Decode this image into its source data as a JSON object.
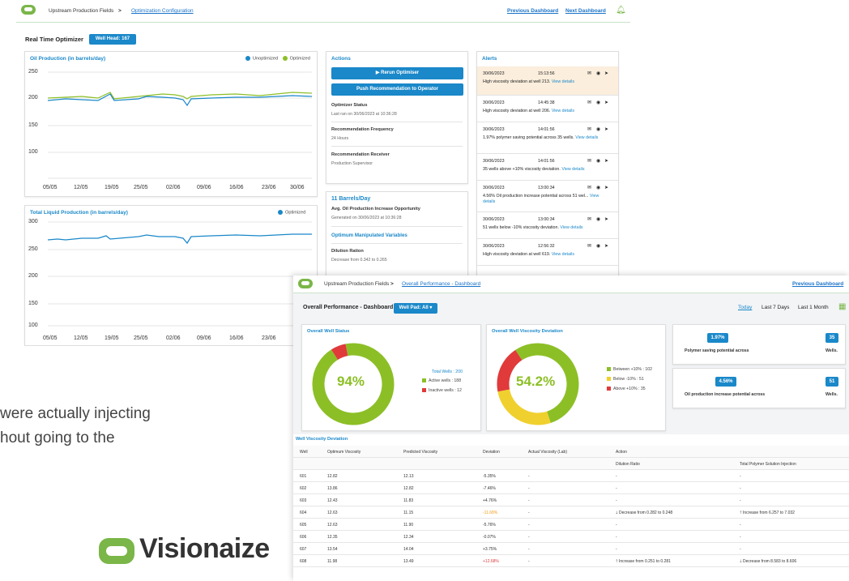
{
  "s1": {
    "breadcrumb": {
      "item1": "Upstream Production Fields",
      "sep": ">",
      "current": "Optimization Configuration"
    },
    "nav": {
      "prev": "Previous Dashboard",
      "next": "Next Dashboard"
    },
    "title": "Real Time Optimizer",
    "wellhead_badge": "Well Head: 167",
    "oil_chart": {
      "title": "Oil Production (in barrels/day)",
      "legend": [
        "Unoptimized",
        "Optimized"
      ],
      "yticks": [
        "250",
        "200",
        "150",
        "100"
      ],
      "xticks": [
        "05/05",
        "12/05",
        "19/05",
        "25/05",
        "02/06",
        "09/06",
        "16/06",
        "23/06",
        "30/06"
      ]
    },
    "liquid_chart": {
      "title": "Total Liquid Production (in barrels/day)",
      "legend": [
        "Optimized"
      ],
      "yticks": [
        "300",
        "250",
        "200",
        "150",
        "100"
      ],
      "xticks": [
        "05/05",
        "12/05",
        "19/05",
        "25/05",
        "02/06",
        "09/06",
        "16/06",
        "23/06"
      ]
    },
    "actions": {
      "title": "Actions",
      "rerun": "▶ Rerun Optimiser",
      "push": "Push Recommendation to Operator",
      "status_label": "Optimizer Status",
      "status_value": "Last ran on 30/06/2023 at 10:36:28",
      "freq_label": "Recommendation Frequency",
      "freq_value": "24 Hours",
      "receiver_label": "Recommendation Receiver",
      "receiver_value": "Production Supervisor"
    },
    "opportunity": {
      "title": "11 Barrels/Day",
      "label": "Avg. Oil Production Increase Opportunity",
      "generated": "Generated on 30/06/2023 at 10:36:28",
      "vars_title": "Optimum Manipulated Variables",
      "dilution_label": "Dilution Ration",
      "dilution_value": "Decrease from 0.342 to 0.265"
    },
    "alerts": {
      "title": "Alerts",
      "items": [
        {
          "date": "30/06/2023",
          "time": "15:13:56",
          "text": "High viscosity deviation at well 213.",
          "view": "View details"
        },
        {
          "date": "30/06/2023",
          "time": "14:45:38",
          "text": "High viscosity deviation at well 206.",
          "view": "View details"
        },
        {
          "date": "30/06/2023",
          "time": "14:01:56",
          "text": "1.97% polymer saving potential across 35 wells.",
          "view": "View details"
        },
        {
          "date": "30/06/2023",
          "time": "14:01:56",
          "text": "35 wells above +10% viscosity deviation.",
          "view": "View details"
        },
        {
          "date": "30/06/2023",
          "time": "13:00:34",
          "text": "4.56% Oil production increase potential across 51 wel...",
          "view": "View details"
        },
        {
          "date": "30/06/2023",
          "time": "13:00:34",
          "text": "51 wells below -10% viscosity deviation.",
          "view": "View details"
        },
        {
          "date": "30/06/2023",
          "time": "12:56:32",
          "text": "High viscosity deviation at well 619.",
          "view": "View details"
        }
      ]
    }
  },
  "s2": {
    "breadcrumb": {
      "item1": "Upstream Production Fields",
      "sep": ">",
      "current": "Overall Performance - Dashboard"
    },
    "nav": {
      "prev": "Previous Dashboard"
    },
    "title": "Overall Performance - Dashboard",
    "wellpad_dropdown": "Well Pad: All ▾",
    "ranges": [
      "Today",
      "Last 7 Days",
      "Last 1 Month"
    ],
    "status": {
      "title": "Overall Well Status",
      "percent": "94%",
      "total": "Total Wells : 200",
      "legend": [
        "Active wells : 188",
        "Inactive wells : 12"
      ],
      "colors": [
        "#8cbf26",
        "#e03a3a"
      ],
      "values": [
        188,
        12
      ]
    },
    "deviation": {
      "title": "Overall Well Viscosity Deviation",
      "percent": "54.2%",
      "legend": [
        "Between +10% : 102",
        "Below -10% : 51",
        "Above +10% : 35"
      ],
      "colors": [
        "#8cbf26",
        "#f0d02e",
        "#e03a3a"
      ],
      "values": [
        102,
        51,
        35
      ]
    },
    "kpi1": {
      "value": "1.97%",
      "text": "Polymer saving potential across",
      "count": "35",
      "unit": "Wells."
    },
    "kpi2": {
      "value": "4.56%",
      "text": "Oil production increase potential across",
      "count": "51",
      "unit": "Wells."
    },
    "table": {
      "title": "Well Viscosity Deviation",
      "headers": [
        "Well",
        "Optimum Viscosity",
        "Predicted Viscosity",
        "Deviation",
        "Actual Viscosity (Lab)",
        "Action"
      ],
      "subheaders": [
        "Dilution Ratio",
        "Total Polymer Solution Injection"
      ],
      "rows": [
        [
          "601",
          "12.82",
          "12.13",
          "-5.35%",
          "-",
          "-",
          "-"
        ],
        [
          "602",
          "13.86",
          "12.82",
          "-7.46%",
          "-",
          "-",
          "-"
        ],
        [
          "603",
          "12.43",
          "11.83",
          "+4.76%",
          "-",
          "-",
          "-"
        ],
        [
          "604",
          "12.63",
          "11.15",
          "-11.68%",
          "-",
          "🡓 Decrease from 0.282 to 0.248",
          "🡑 Increase from 6.257 to 7.032"
        ],
        [
          "605",
          "12.63",
          "11.90",
          "-5.76%",
          "-",
          "-",
          "-"
        ],
        [
          "606",
          "12.35",
          "12.34",
          "-0.07%",
          "-",
          "-",
          "-"
        ],
        [
          "607",
          "13.54",
          "14.04",
          "+3.75%",
          "-",
          "-",
          "-"
        ],
        [
          "608",
          "11.98",
          "13.49",
          "+12.68%",
          "-",
          "🡑 Increase from 0.251 to 0.281",
          "🡓 Decrease from 8.583 to 8.606"
        ]
      ],
      "deviation_colors": [
        "#333",
        "#333",
        "#333",
        "#f0a020",
        "#333",
        "#333",
        "#333",
        "#e03a3a"
      ]
    }
  },
  "slide": {
    "tagline1": "were actually injecting",
    "tagline2": "hout going to the",
    "brand": "Visionaize"
  }
}
